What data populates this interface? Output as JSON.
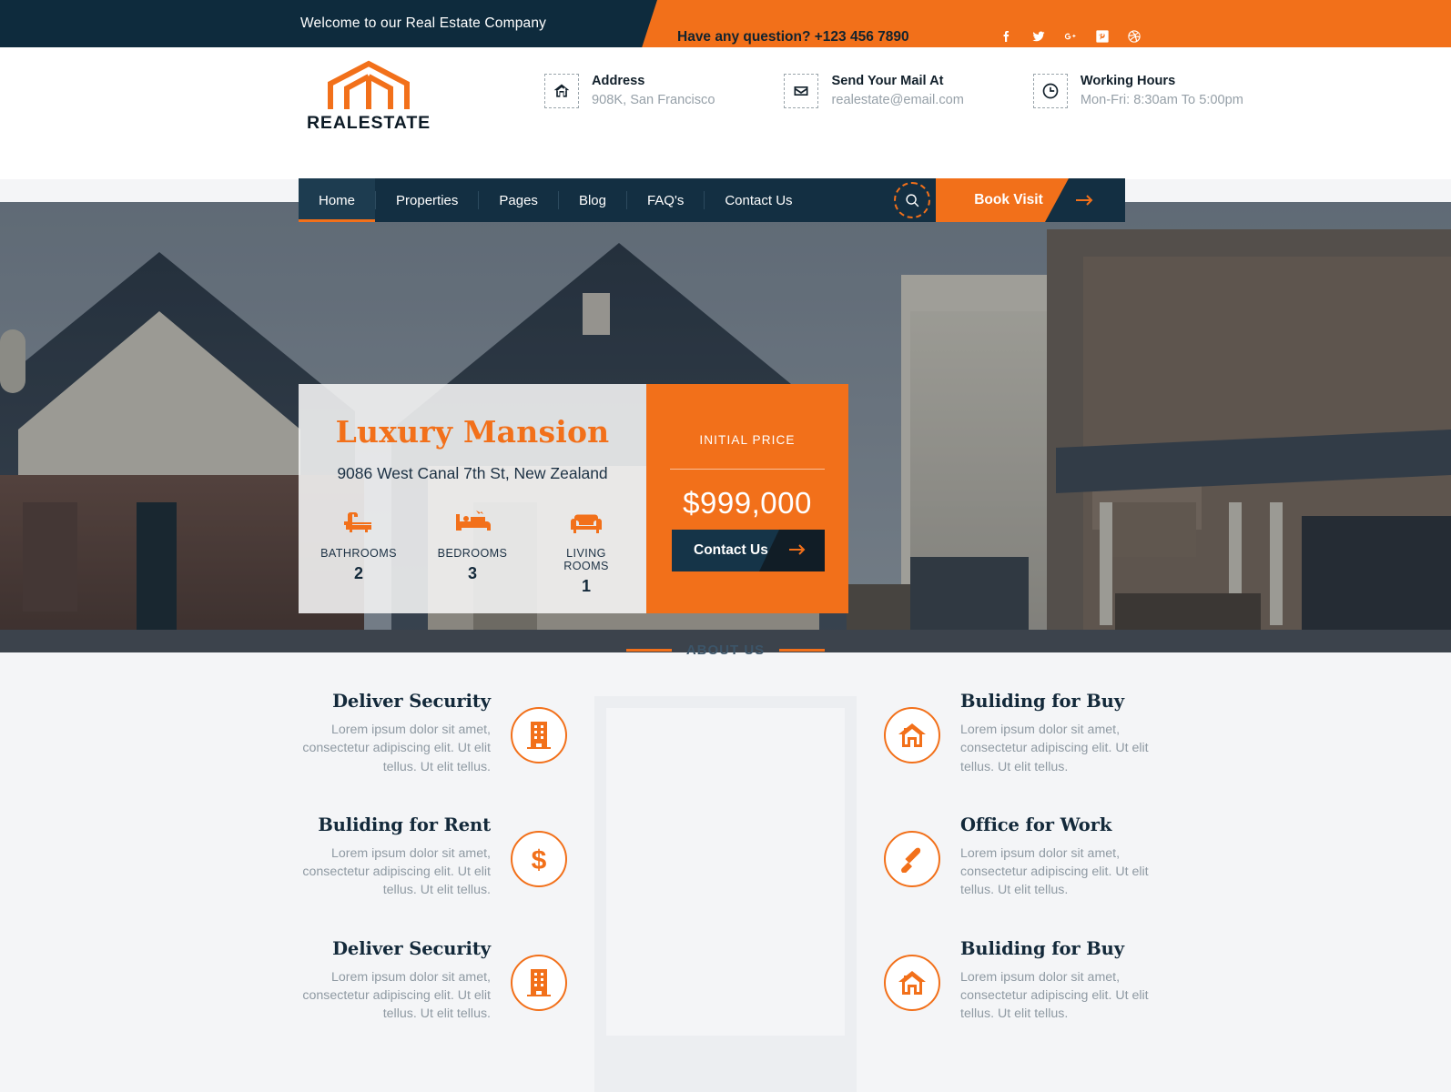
{
  "topbar": {
    "welcome": "Welcome to our Real Estate Company",
    "question": "Have any question? +123 456 7890",
    "socials": [
      {
        "name": "facebook-icon"
      },
      {
        "name": "twitter-icon"
      },
      {
        "name": "google-plus-icon"
      },
      {
        "name": "pinterest-icon"
      },
      {
        "name": "dribbble-icon"
      }
    ],
    "bg_color": "#0e2b3d",
    "accent_color": "#f2701a"
  },
  "header": {
    "logo_word": "REALESTATE",
    "infos": [
      {
        "icon": "home-icon",
        "title": "Address",
        "value": "908K, San Francisco"
      },
      {
        "icon": "envelope-icon",
        "title": "Send Your Mail At",
        "value": "realestate@email.com"
      },
      {
        "icon": "clock-icon",
        "title": "Working Hours",
        "value": "Mon-Fri: 8:30am To 5:00pm"
      }
    ]
  },
  "nav": {
    "items": [
      {
        "label": "Home",
        "active": true
      },
      {
        "label": "Properties",
        "active": false
      },
      {
        "label": "Pages",
        "active": false
      },
      {
        "label": "Blog",
        "active": false
      },
      {
        "label": "FAQ's",
        "active": false
      },
      {
        "label": "Contact Us",
        "active": false
      }
    ],
    "search_icon": "search-icon",
    "book_visit": "Book Visit",
    "arrow_icon": "arrow-right-icon"
  },
  "hero": {
    "title": "Luxury Mansion",
    "address": "9086 West Canal 7th St, New Zealand",
    "specs": [
      {
        "icon": "bathtub-icon",
        "label": "BATHROOMS",
        "value": "2"
      },
      {
        "icon": "bed-icon",
        "label": "BEDROOMS",
        "value": "3"
      },
      {
        "icon": "sofa-icon",
        "label": "LIVING ROOMS",
        "value": "1"
      }
    ],
    "price_label": "INITIAL PRICE",
    "price_value": "$999,000",
    "contact_button": "Contact Us"
  },
  "about": {
    "section_label": "ABOUT US",
    "left_features": [
      {
        "title": "Deliver Security",
        "text": "Lorem ipsum dolor sit amet, consectetur adipiscing elit. Ut elit tellus. Ut elit tellus.",
        "icon": "building-icon"
      },
      {
        "title": "Buliding for Rent",
        "text": "Lorem ipsum dolor sit amet, consectetur adipiscing elit. Ut elit tellus. Ut elit tellus.",
        "icon": "dollar-icon"
      },
      {
        "title": "Deliver Security",
        "text": "Lorem ipsum dolor sit amet, consectetur adipiscing elit. Ut elit tellus. Ut elit tellus.",
        "icon": "building-icon"
      }
    ],
    "right_features": [
      {
        "title": "Buliding for Buy",
        "text": "Lorem ipsum dolor sit amet, consectetur adipiscing elit. Ut elit tellus. Ut elit tellus.",
        "icon": "house-icon"
      },
      {
        "title": "Office for Work",
        "text": "Lorem ipsum dolor sit amet, consectetur adipiscing elit. Ut elit tellus. Ut elit tellus.",
        "icon": "tool-icon"
      },
      {
        "title": "Buliding for Buy",
        "text": "Lorem ipsum dolor sit amet, consectetur adipiscing elit. Ut elit tellus. Ut elit tellus.",
        "icon": "house-icon"
      }
    ]
  }
}
